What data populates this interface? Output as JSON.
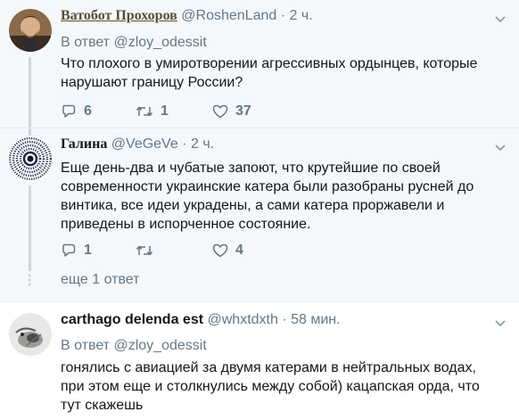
{
  "tweets": [
    {
      "name": "Ватобот Прохоров",
      "handle": "@RoshenLand",
      "sep": "·",
      "time": "2 ч.",
      "reply_to_prefix": "В ответ",
      "reply_to": "@zloy_odessit",
      "text": "Что плохого в умиротворении агрессивных ордынцев, которые\nнарушают границу России?",
      "replies": "6",
      "retweets": "1",
      "likes": "37"
    },
    {
      "name": "Галина",
      "handle": "@VeGeVe",
      "sep": "·",
      "time": "2 ч.",
      "text": "Еще день-два и чубатые запоют, что крутейшие по своей\nсовременности украинские катера были разобраны русней до\nвинтика, все идеи украдены, а сами катера проржавели и\nприведены в испорченное состояние.",
      "replies": "1",
      "retweets": "",
      "likes": "4",
      "more_replies": "еще 1 ответ"
    },
    {
      "name": "carthago delenda est",
      "handle": "@whxtdxth",
      "sep": "·",
      "time": "58 мин.",
      "reply_to_prefix": "В ответ",
      "reply_to": "@zloy_odessit",
      "text": "гонялись с авиацией за двумя катерами в нейтральных водах,\nпри этом еще и столкнулись между собой) кацапская орда, что\nтут скажешь"
    }
  ],
  "colors": {
    "secondary_text": "#657786",
    "primary_text": "#14171a",
    "thread_line": "#ccd6dd",
    "reply_bg": "#f5f8fa"
  },
  "icons": [
    "reply-icon",
    "retweet-icon",
    "like-icon",
    "caret-down-icon"
  ]
}
